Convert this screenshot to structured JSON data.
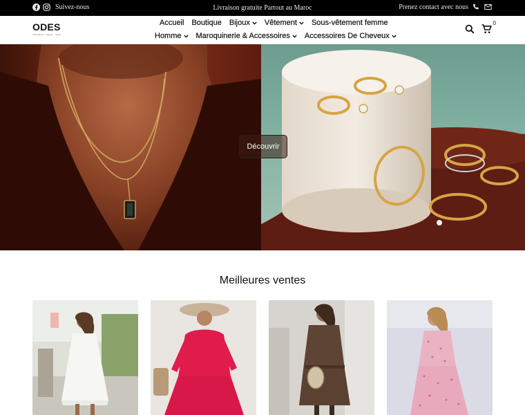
{
  "topbar": {
    "follow_text": "Suivez-nous",
    "promo_text": "Livraison gratuite Partout au Maroc",
    "contact_text": "Prenez contact avec nous",
    "icons": [
      "facebook-icon",
      "instagram-icon",
      "phone-icon",
      "mail-icon"
    ]
  },
  "header": {
    "logo_text": "ODES",
    "logo_tagline": "vêtements · bijoux · style",
    "nav_row1": [
      {
        "label": "Accueil",
        "dropdown": false
      },
      {
        "label": "Boutique",
        "dropdown": false
      },
      {
        "label": "Bijoux",
        "dropdown": true
      },
      {
        "label": "Vêtement",
        "dropdown": true
      },
      {
        "label": "Sous-vêtement femme",
        "dropdown": false
      }
    ],
    "nav_row2": [
      {
        "label": "Homme",
        "dropdown": true
      },
      {
        "label": "Maroquinerie & Accessoires",
        "dropdown": true
      },
      {
        "label": "Accessoires De Cheveux",
        "dropdown": true
      }
    ],
    "cart_count": "0",
    "icons": [
      "search-icon",
      "cart-icon"
    ]
  },
  "hero": {
    "button_label": "Découvrir"
  },
  "best_sellers": {
    "title": "Meilleures ventes",
    "products": [
      {
        "name": "white-lace-dress",
        "bg": "#d9d9d2"
      },
      {
        "name": "red-ruffle-dress",
        "bg": "#e6e2dc"
      },
      {
        "name": "brown-knit-dress",
        "bg": "#d5d0c8"
      },
      {
        "name": "pink-floral-dress",
        "bg": "#d9dbe6"
      }
    ]
  },
  "colors": {
    "topbar_bg": "#000000",
    "topbar_text": "#e8e8e8",
    "text": "#111111"
  }
}
